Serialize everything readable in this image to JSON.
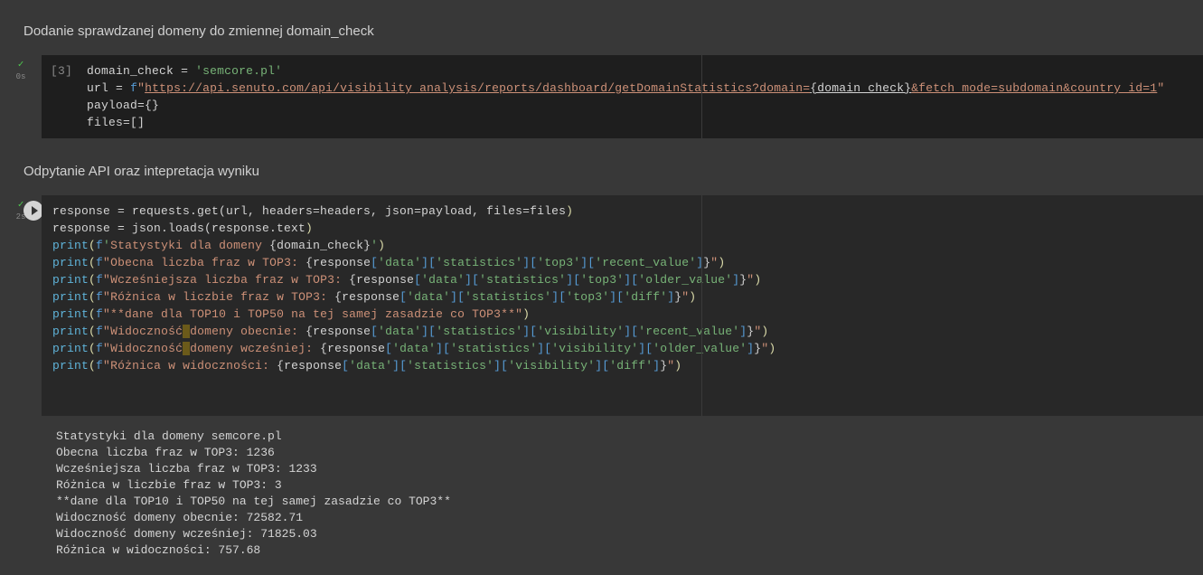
{
  "headings": {
    "h1": "Dodanie sprawdzanej domeny do zmiennej domain_check",
    "h2": "Odpytanie API oraz intepretacja wyniku"
  },
  "cell1": {
    "prompt": "[3]",
    "timing": "0s",
    "code": {
      "domain_var": "domain_check",
      "domain_val": "'semcore.pl'",
      "url_var": "url",
      "url_prefix": "f\"",
      "url_base": "https://api.senuto.com/api/visibility_analysis/reports/dashboard/getDomainStatistics?domain=",
      "url_expr": "{domain_check}",
      "url_tail": "&fetch_mode=subdomain&country_id=1",
      "url_close": "\"",
      "payload": "payload={}",
      "files": "files=[]"
    }
  },
  "cell2": {
    "timing": "2s",
    "lines": {
      "l1a": "response = requests.get(url, headers=headers, json=payload, files=files)",
      "l2a": "response = json.loads(response.text)",
      "p1_pre": "print(f'",
      "p1_text": "Statystyki dla domeny ",
      "p1_expr": "{domain_check}",
      "p1_post": "')",
      "p2_pre": "print(f\"",
      "p2_text": "Obecna liczba fraz w TOP3: ",
      "p2_expr_open": "{response[",
      "p2_k1": "'data'",
      "p2_b1": "][",
      "p2_k2": "'statistics'",
      "p2_b2": "][",
      "p2_k3": "'top3'",
      "p2_b3": "][",
      "p2_k4": "'recent_value'",
      "p2_close": "]}\")",
      "p3_text": "Wcześniejsza liczba fraz w TOP3: ",
      "p3_k4": "'older_value'",
      "p4_text": "Różnica w liczbie fraz w TOP3: ",
      "p4_k4": "'diff'",
      "p5": "print(f\"**dane dla TOP10 i TOP50 na tej samej zasadzie co TOP3**\")",
      "p6_text": "Widoczność",
      "p6_text2": "domeny obecnie: ",
      "p6_k3": "'visibility'",
      "p7_text2": "domeny wcześniej: ",
      "p8_text": "Różnica w widoczności: "
    }
  },
  "output": {
    "o1": "Statystyki dla domeny semcore.pl",
    "o2": "Obecna liczba fraz w TOP3: 1236",
    "o3": "Wcześniejsza liczba fraz w TOP3: 1233",
    "o4": "Różnica w liczbie fraz w TOP3: 3",
    "o5": "**dane dla TOP10 i TOP50 na tej samej zasadzie co TOP3**",
    "o6": "Widoczność domeny obecnie: 72582.71",
    "o7": "Widoczność domeny wcześniej: 71825.03",
    "o8": "Różnica w widoczności: 757.68"
  }
}
